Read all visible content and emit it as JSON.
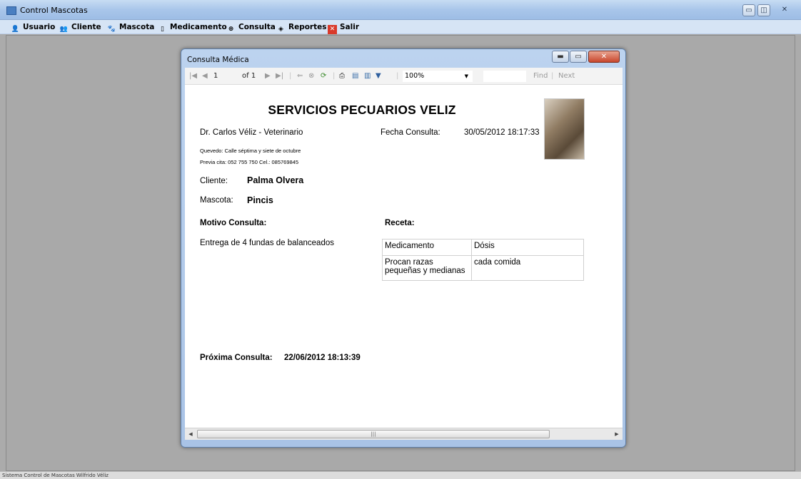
{
  "window": {
    "title": "Control Mascotas"
  },
  "menu": [
    {
      "label": "Usuario",
      "icon": "user-icon"
    },
    {
      "label": "Cliente",
      "icon": "client-icon"
    },
    {
      "label": "Mascota",
      "icon": "pet-icon"
    },
    {
      "label": "Medicamento",
      "icon": "medicine-icon"
    },
    {
      "label": "Consulta",
      "icon": "consult-icon"
    },
    {
      "label": "Reportes",
      "icon": "reports-icon"
    },
    {
      "label": "Salir",
      "icon": "exit-icon"
    }
  ],
  "child_window": {
    "title": "Consulta Médica"
  },
  "toolbar": {
    "page": "1",
    "page_of": "of 1",
    "zoom": "100%",
    "find": "Find",
    "next": "Next"
  },
  "report": {
    "company": "SERVICIOS PECUARIOS VELIZ",
    "doctor": "Dr. Carlos Véliz - Veterinario",
    "fecha_label": "Fecha Consulta:",
    "fecha_value": "30/05/2012 18:17:33",
    "address": "Quevedo: Calle séptima y siete de octubre",
    "phone": "Previa cita: 052 755 750  Cel.: 085769845",
    "cliente_label": "Cliente:",
    "cliente_value": "Palma Olvera",
    "mascota_label": "Mascota:",
    "mascota_value": "Pincis",
    "motivo_label": "Motivo Consulta:",
    "motivo_value": "Entrega de 4 fundas de balanceados",
    "receta_label": "Receta:",
    "receta_headers": [
      "Medicamento",
      "Dósis"
    ],
    "receta_rows": [
      [
        "Procan razas pequeñas y medianas",
        "cada comida"
      ]
    ],
    "proxima_label": "Próxima Consulta:",
    "proxima_value": "22/06/2012 18:13:39"
  },
  "status": {
    "text": "Sistema Control de Mascotas Wilfrido Véliz"
  }
}
